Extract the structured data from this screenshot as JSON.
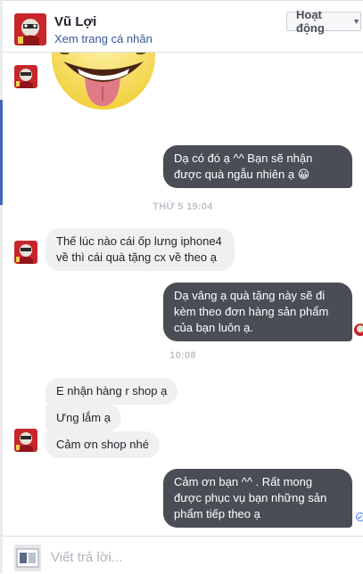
{
  "header": {
    "name": "Vũ Lợi",
    "profile_link": "Xem trang cá nhân",
    "status_button": "Hoạt động"
  },
  "conversation": {
    "msg_outgoing_1": "Dạ có đó ạ ^^ Bạn sẽ nhận được quà ngẫu nhiên ạ 😀",
    "timestamp_1": "THỨ 5 19:04",
    "msg_incoming_1": "Thế lúc nào cái ốp lưng iphone4 về thì cái quà tặng cx về theo ạ",
    "msg_outgoing_2": "Dạ vâng ạ quà tặng này sẽ đi kèm theo đơn hàng sản phẩm của bạn luôn ạ.",
    "timestamp_2": "10:08",
    "msg_incoming_2": "E nhận hàng r shop ạ",
    "msg_incoming_3": "Ưng lắm ạ",
    "msg_incoming_4": "Cảm ơn shop nhé",
    "msg_outgoing_3": "Cảm ơn bạn ^^ . Rất mong được phục vụ bạn những sản phẩm tiếp theo ạ"
  },
  "reply": {
    "placeholder": "Viết trả lời..."
  },
  "colors": {
    "outgoing_bubble": "#4a4d55",
    "incoming_bubble": "#f1f0f0",
    "link": "#365899",
    "accent": "#4267b2"
  }
}
